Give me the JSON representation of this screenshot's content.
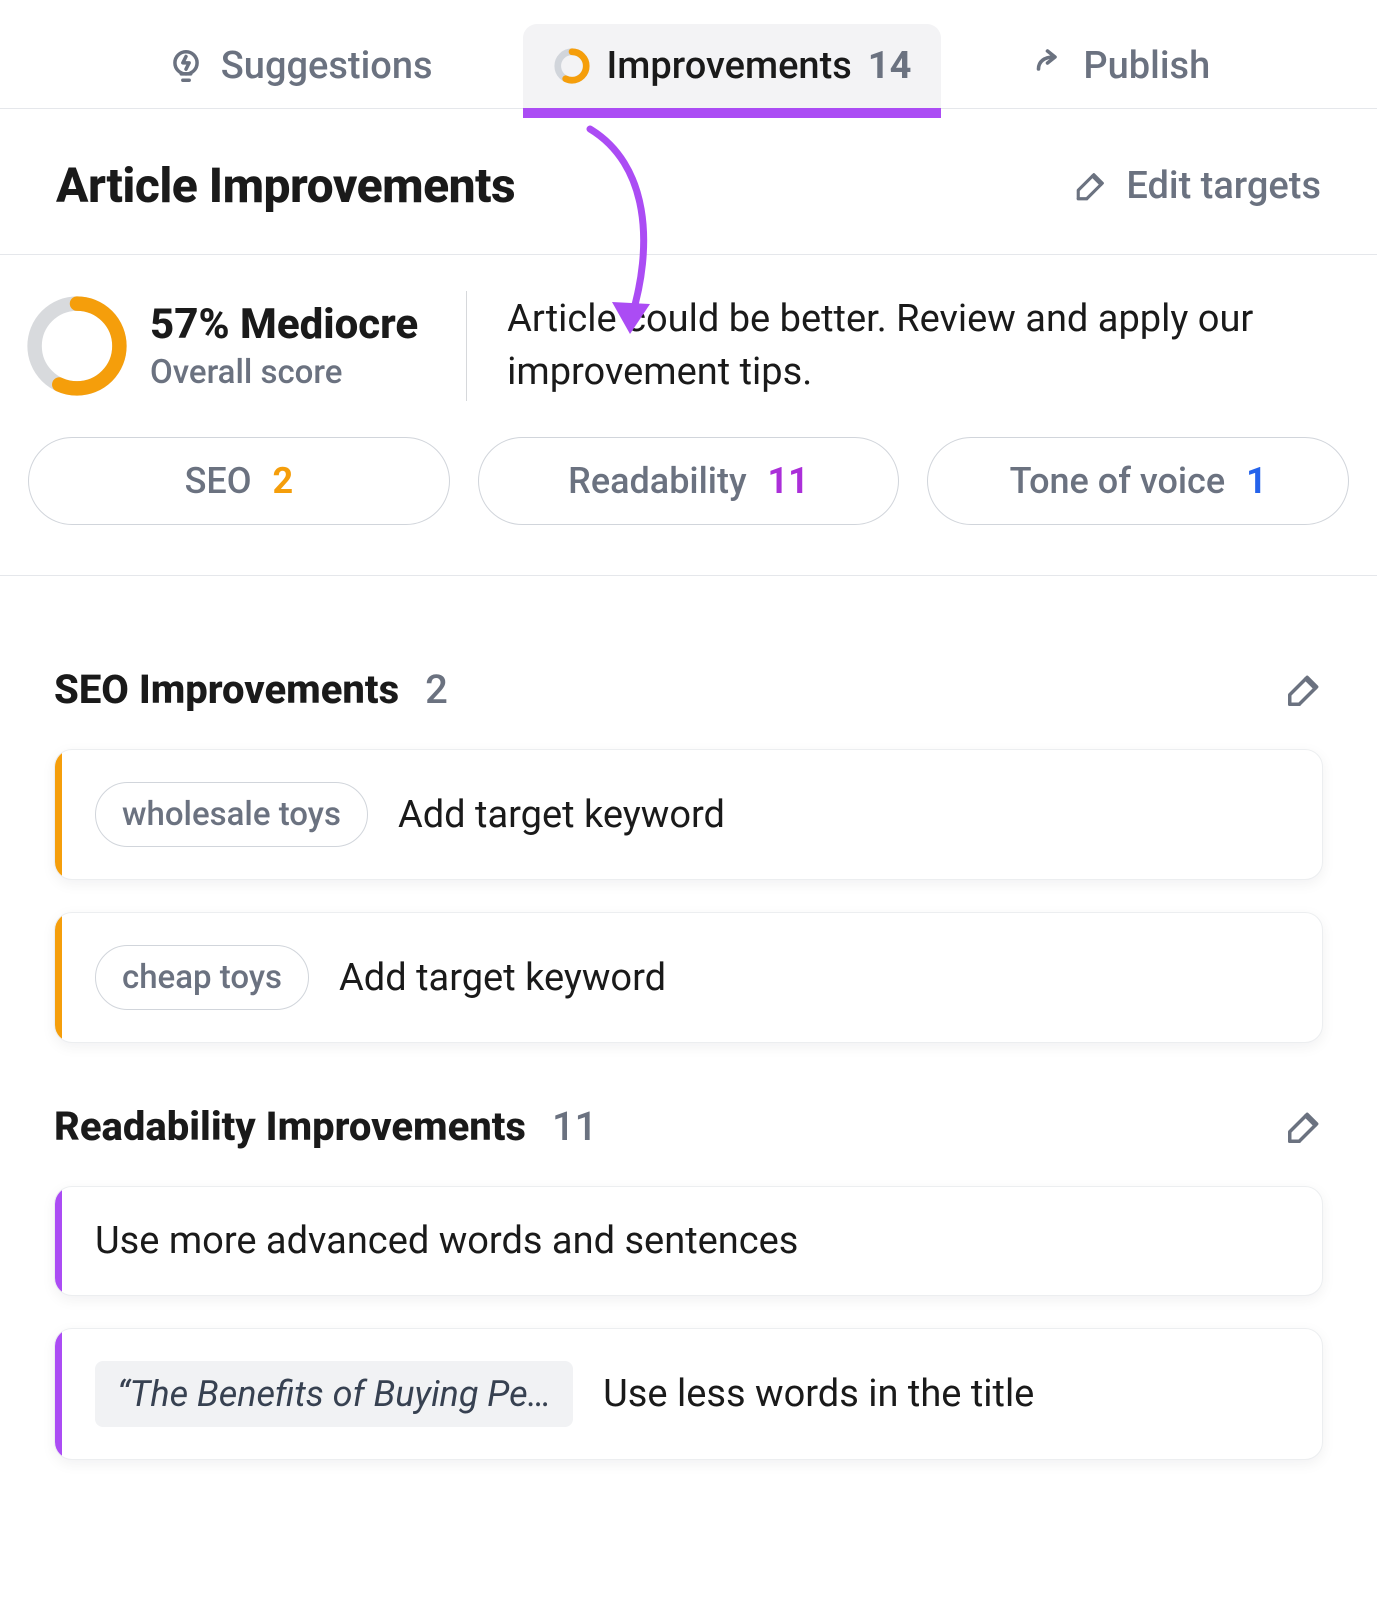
{
  "tabs": {
    "suggestions": "Suggestions",
    "improvements_label": "Improvements",
    "improvements_count": "14",
    "publish": "Publish"
  },
  "header": {
    "title": "Article Improvements",
    "edit_targets": "Edit targets"
  },
  "score": {
    "percent": 57,
    "percent_label": "57% Mediocre",
    "sub": "Overall score",
    "desc": "Article could be better. Review and apply our improvement tips."
  },
  "filters": {
    "seo_label": "SEO",
    "seo_count": "2",
    "readability_label": "Readability",
    "readability_count": "11",
    "tone_label": "Tone of voice",
    "tone_count": "1"
  },
  "sections": {
    "seo": {
      "title": "SEO Improvements",
      "count": "2",
      "items": [
        {
          "keyword": "wholesale toys",
          "action": "Add target keyword"
        },
        {
          "keyword": "cheap toys",
          "action": "Add target keyword"
        }
      ]
    },
    "readability": {
      "title": "Readability Improvements",
      "count": "11",
      "items": [
        {
          "snippet": "",
          "action": "Use more advanced words and sentences"
        },
        {
          "snippet": "“The Benefits of Buying Pe…",
          "action": "Use less words in the title"
        }
      ]
    }
  }
}
